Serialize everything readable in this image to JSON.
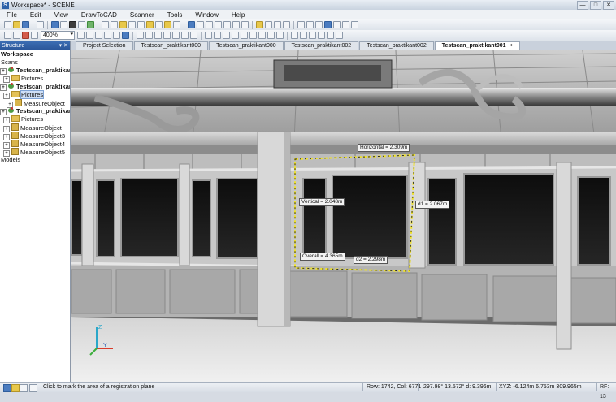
{
  "window": {
    "title": "Workspace* - SCENE",
    "app_icon": "S",
    "buttons": [
      "—",
      "□",
      "✕"
    ]
  },
  "menu": [
    "File",
    "Edit",
    "View",
    "DrawToCAD",
    "Scanner",
    "Tools",
    "Window",
    "Help"
  ],
  "toolbar": {
    "zoom": "400%"
  },
  "structure": {
    "header": "Structure",
    "header_buttons": "▾ ✕",
    "items": [
      {
        "label": "Workspace",
        "level": 0,
        "bold": true,
        "icon": "none"
      },
      {
        "label": "Scans",
        "level": 0,
        "bold": false,
        "icon": "none"
      },
      {
        "label": "Testscan_praktikant0",
        "level": 0,
        "bold": true,
        "icon": "scan-icon"
      },
      {
        "label": "Pictures",
        "level": 1,
        "bold": false,
        "icon": "folder-icon"
      },
      {
        "label": "Testscan_praktikant0",
        "level": 0,
        "bold": true,
        "icon": "scan-icon"
      },
      {
        "label": "Pictures",
        "level": 1,
        "bold": false,
        "icon": "folder-icon",
        "selected": true
      },
      {
        "label": "MeasureObject",
        "level": 2,
        "bold": false,
        "icon": "measure-icon"
      },
      {
        "label": "Testscan_praktikant0",
        "level": 0,
        "bold": true,
        "icon": "scan-icon"
      },
      {
        "label": "Pictures",
        "level": 1,
        "bold": false,
        "icon": "folder-icon"
      },
      {
        "label": "MeasureObject",
        "level": 1,
        "bold": false,
        "icon": "measure-icon"
      },
      {
        "label": "MeasureObject3",
        "level": 1,
        "bold": false,
        "icon": "measure-icon"
      },
      {
        "label": "MeasureObject4",
        "level": 1,
        "bold": false,
        "icon": "measure-icon"
      },
      {
        "label": "MeasureObject5",
        "level": 1,
        "bold": false,
        "icon": "measure-icon"
      },
      {
        "label": "Models",
        "level": 0,
        "bold": false,
        "icon": "none"
      }
    ]
  },
  "tabs": [
    {
      "label": "Project Selection",
      "active": false
    },
    {
      "label": "Testscan_praktikant000",
      "active": false
    },
    {
      "label": "Testscan_praktikant000",
      "active": false
    },
    {
      "label": "Testscan_praktikant002",
      "active": false
    },
    {
      "label": "Testscan_praktikant002",
      "active": false
    },
    {
      "label": "Testscan_praktikant001",
      "active": true
    }
  ],
  "tab_close": "×",
  "measurements": {
    "horizontal": "Horizontal = 2.309m",
    "vertical": "Vertical = 2.048m",
    "d1": "d1 = 2.067m",
    "overall": "Overall = 4.365m",
    "d2": "d2 = 2.298m"
  },
  "axis": {
    "z": "Z",
    "y": "Y"
  },
  "status": {
    "hint": "Click to mark the area of a registration plane",
    "row_col": "Row: 1742, Col: 6771",
    "angles": "297.98° 13.572°  d: 9.396m",
    "xyz": "XYZ: -6.124m 6.753m 309.965m",
    "rf": "RF: 13"
  }
}
